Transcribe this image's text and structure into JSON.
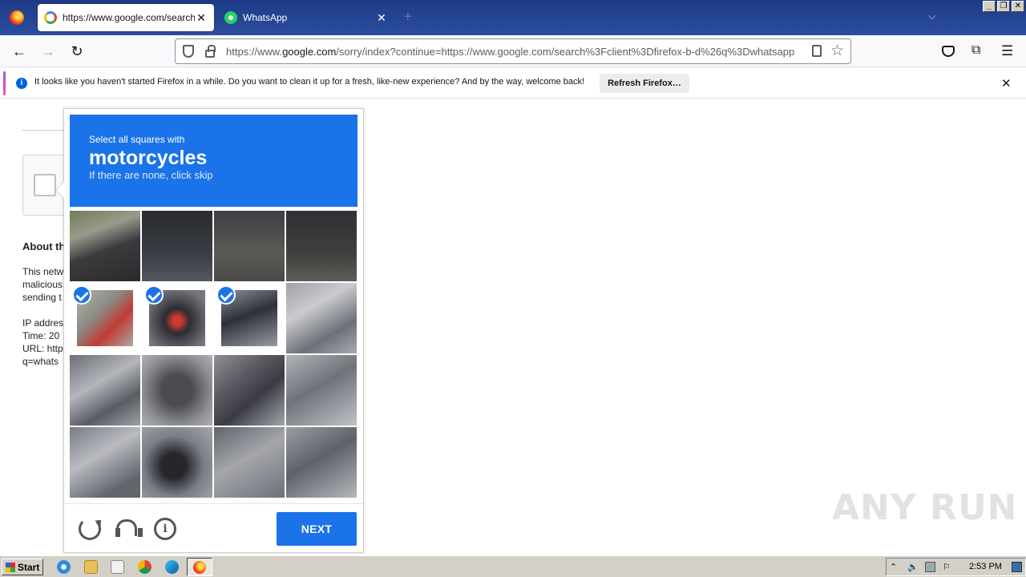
{
  "browser": {
    "tabs": [
      {
        "title": "https://www.google.com/search?c",
        "active": true
      },
      {
        "title": "WhatsApp",
        "active": false
      }
    ],
    "url": {
      "prefix": "https://www.",
      "domain": "google.com",
      "rest": "/sorry/index?continue=https://www.google.com/search%3Fclient%3Dfirefox-b-d%26q%3Dwhatsapp"
    },
    "notification": {
      "text": "It looks like you haven't started Firefox in a while. Do you want to clean it up for a fresh, like-new experience? And by the way, welcome back!",
      "button": "Refresh Firefox…"
    }
  },
  "page": {
    "about_title": "About th",
    "lines": [
      "This netw",
      "malicious",
      "sending t",
      "IP addres",
      "Time: 20",
      "URL: http",
      "q=whats"
    ]
  },
  "captcha": {
    "prefix": "Select all squares with",
    "object": "motorcycles",
    "hint": "If there are none, click skip",
    "selected_tiles": [
      4,
      5,
      6
    ],
    "next_label": "NEXT"
  },
  "watermark": "ANY RUN",
  "taskbar": {
    "start_label": "Start",
    "clock": "2:53 PM"
  },
  "colors": {
    "accent": "#1a73e8",
    "tabstrip": "#1c3a86"
  }
}
